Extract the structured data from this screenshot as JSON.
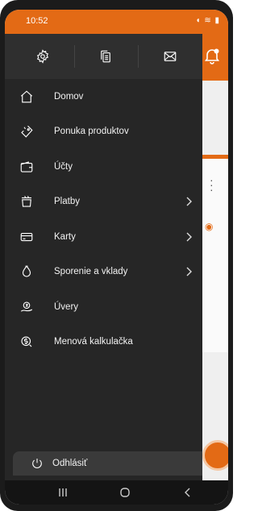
{
  "status_bar": {
    "time": "10:52",
    "indicators": "◖ ≋ ▮"
  },
  "drawer": {
    "top_icons": [
      "settings-icon",
      "documents-icon",
      "mail-icon"
    ],
    "items": [
      {
        "label": "Domov",
        "icon": "home-icon",
        "has_submenu": false
      },
      {
        "label": "Ponuka produktov",
        "icon": "tag-icon",
        "has_submenu": false
      },
      {
        "label": "Účty",
        "icon": "wallet-icon",
        "has_submenu": false
      },
      {
        "label": "Platby",
        "icon": "payments-icon",
        "has_submenu": true
      },
      {
        "label": "Karty",
        "icon": "card-icon",
        "has_submenu": true
      },
      {
        "label": "Sporenie a vklady",
        "icon": "savings-icon",
        "has_submenu": true
      },
      {
        "label": "Úvery",
        "icon": "loan-icon",
        "has_submenu": false
      },
      {
        "label": "Menová kalkulačka",
        "icon": "currency-calculator-icon",
        "has_submenu": false
      }
    ],
    "logout_label": "Odhlásiť"
  },
  "colors": {
    "accent": "#e36a15",
    "drawer_bg": "#262626",
    "drawer_header": "#2f2f2f"
  },
  "nav_bar": [
    "recents-icon",
    "home-icon",
    "back-icon"
  ]
}
